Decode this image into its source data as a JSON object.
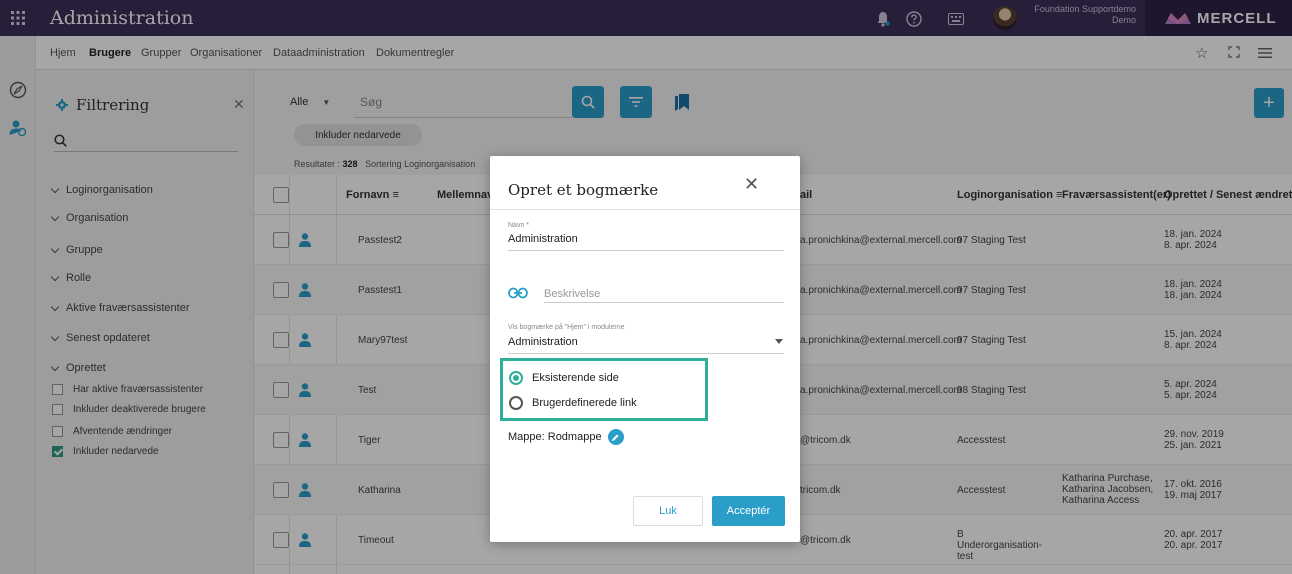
{
  "topbar": {
    "app_title": "Administration",
    "account_line1": "Foundation Supportdemo",
    "account_line2": "Demo",
    "brand": "MERCELL"
  },
  "nav": {
    "items": [
      "Hjem",
      "Brugere",
      "Grupper",
      "Organisationer",
      "Dataadministration",
      "Dokumentregler"
    ],
    "active": "Brugere"
  },
  "filter": {
    "title": "Filtrering",
    "sections": [
      "Loginorganisation",
      "Organisation",
      "Gruppe",
      "Rolle",
      "Aktive fraværsassistenter",
      "Senest opdateret",
      "Oprettet"
    ],
    "checks": [
      {
        "label": "Har aktive fraværsassistenter",
        "checked": false
      },
      {
        "label": "Inkluder deaktiverede brugere",
        "checked": false
      },
      {
        "label": "Afventende ændringer",
        "checked": false
      },
      {
        "label": "Inkluder nedarvede",
        "checked": true
      }
    ]
  },
  "toolbar": {
    "scope": "Alle",
    "search_placeholder": "Søg",
    "inherit_chip": "Inkluder nedarvede",
    "results_label": "Resultater :",
    "results_count": "328",
    "sort_label": "Sortering",
    "sort_value": "Loginorganisation"
  },
  "table": {
    "headers": {
      "fornavn": "Fornavn ≡",
      "mellemnavn": "Mellemnavn",
      "email": "ail",
      "login": "Loginorganisation ≡",
      "absence": "Fraværsassistent(er)",
      "created": "Oprettet / Senest ændret ≡"
    },
    "rows": [
      {
        "name": "Passtest2",
        "email": "a.pronichkina@external.mercell.com",
        "org": "97 Staging Test",
        "absence": [],
        "created": "18. jan. 2024",
        "changed": "8. apr. 2024"
      },
      {
        "name": "Passtest1",
        "email": "a.pronichkina@external.mercell.com",
        "org": "97 Staging Test",
        "absence": [],
        "created": "18. jan. 2024",
        "changed": "18. jan. 2024"
      },
      {
        "name": "Mary97test",
        "email": "a.pronichkina@external.mercell.com",
        "org": "97 Staging Test",
        "absence": [],
        "created": "15. jan. 2024",
        "changed": "8. apr. 2024"
      },
      {
        "name": "Test",
        "email": "a.pronichkina@external.mercell.com",
        "org": "98 Staging Test",
        "absence": [],
        "created": "5. apr. 2024",
        "changed": "5. apr. 2024"
      },
      {
        "name": "Tiger",
        "email": "@tricom.dk",
        "org": "Accesstest",
        "absence": [],
        "created": "29. nov. 2019",
        "changed": "25. jan. 2021"
      },
      {
        "name": "Katharina",
        "email": "tricom.dk",
        "org": "Accesstest",
        "absence": [
          "Katharina Purchase,",
          "Katharina Jacobsen,",
          "Katharina Access"
        ],
        "created": "17. okt. 2016",
        "changed": "19. maj 2017"
      },
      {
        "name": "Timeout",
        "email": "@tricom.dk",
        "org": "B Underorganisation- test",
        "absence": [],
        "created": "20. apr. 2017",
        "changed": "20. apr. 2017"
      }
    ]
  },
  "modal": {
    "title": "Opret et bogmærke",
    "name_label": "Navn *",
    "name_value": "Administration",
    "description_placeholder": "Beskrivelse",
    "show_label": "Vis bogmærke på \"Hjem\" i modulerne",
    "show_value": "Administration",
    "radio_existing": "Eksisterende side",
    "radio_custom": "Brugerdefinerede link",
    "folder": "Mappe: Rodmappe",
    "close_button": "Luk",
    "accept_button": "Acceptér"
  },
  "colors": {
    "topbar": "#3d2f5a",
    "accent_blue": "#2a9ec9",
    "accent_teal": "#2fae9a"
  }
}
